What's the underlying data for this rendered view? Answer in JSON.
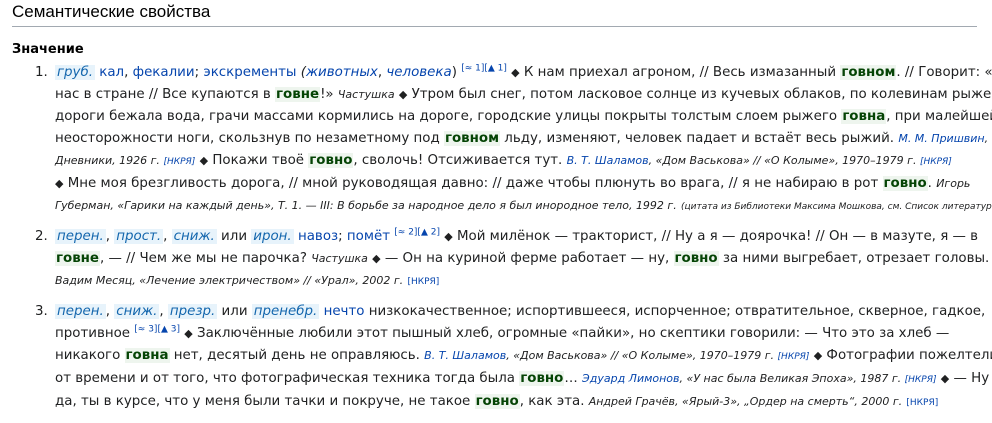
{
  "section_title": "Семантические свойства",
  "subsection_title": "Значение",
  "common": {
    "bullet": "◆",
    "nkrya": "[НКРЯ]"
  },
  "sense1": {
    "num": "1.",
    "label1": "груб.",
    "defs": "кал",
    "def2": "фекалии",
    "def3": "экскременты",
    "paren_open": "(",
    "paren_note1": "животных",
    "paren_note2": "человека",
    "paren_close": ")",
    "sup": "[≈ 1][▲ 1]",
    "q1_a": "К нам приехал агроном, // Весь измазанный ",
    "q1_hw": "говном",
    "q1_b": ". // Говорит: «У нас в стране // Все купаются в ",
    "q1_hw2": "говне",
    "q1_c": "!»",
    "q1_src": "Частушка",
    "q2_a": "Утром был снег, потом ласковое солнце из кучевых облаков, по колевинам рыжей дороги бежала вода, грачи массами кормились на дороге, городские улицы покрыты толстым слоем рыжего ",
    "q2_hw": "говна",
    "q2_b": ", при малейшей неосторожности ноги, скользнув по незаметному под ",
    "q2_hw2": "говном",
    "q2_c": " льду, изменяют, человек падает и встаёт весь рыжий.",
    "q2_src_author": "М. М. Пришвин",
    "q2_src_rest": ", Дневники, 1926 г.",
    "q3_a": "Покажи твоё ",
    "q3_hw": "говно",
    "q3_b": ", сволочь! Отсиживается тут.",
    "q3_src_author": "В. Т. Шаламов",
    "q3_src_rest": ", «Дом Васькова» // «О Колыме», 1970–1979 г.",
    "q4_a": "Мне моя брезгливость дорога, // мной руководящая давно: // даже чтобы плюнуть во врага, // я не набираю в рот ",
    "q4_hw": "говно",
    "q4_b": ".",
    "q4_src": "Игорь Губерман, «Гарики на каждый день», Т. 1. — III: В борьбе за народное дело я был инородное тело, 1992 г.",
    "q4_note": "(цитата из Библиотеки Максима Мошкова, см. Список литературы)"
  },
  "sense2": {
    "num": "2.",
    "label1": "перен.",
    "label2": "прост.",
    "label3": "сниж.",
    "or": " или ",
    "label4": "ирон.",
    "def1": "навоз",
    "def2": "помёт",
    "sup": "[≈ 2][▲ 2]",
    "q1_a": "Мой милёнок — тракторист, // Ну а я — доярочка! // Он — в мазуте, я — в ",
    "q1_hw": "говне",
    "q1_b": ", — // Чем же мы не парочка?",
    "q1_src": "Частушка",
    "q2_a": " — Он на куриной ферме работает — ну, ",
    "q2_hw": "говно",
    "q2_b": " за ними выгребает, отрезает головы.",
    "q2_src": "Вадим Месяц, «Лечение электричеством» // «Урал», 2002 г."
  },
  "sense3": {
    "num": "3.",
    "label1": "перен.",
    "label2": "сниж.",
    "label3": "презр.",
    "or": " или ",
    "label4": "пренебр.",
    "def1": "нечто",
    "def_rest": " низкокачественное; испортившееся, испорченное; отвратительное, скверное, гадкое, противное",
    "sup": "[≈ 3][▲ 3]",
    "q1_a": "Заключённые любили этот пышный хлеб, огромные «пайки», но скептики говорили: — Что это за хлеб — никакого ",
    "q1_hw": "говна",
    "q1_b": " нет, десятый день не оправляюсь.",
    "q1_src_author": "В. Т. Шаламов",
    "q1_src_rest": ", «Дом Васькова» // «О Колыме», 1970–1979 г.",
    "q2_a": "Фотографии пожелтели от времени и от того, что фотографическая техника тогда была ",
    "q2_hw": "говно",
    "q2_b": "…",
    "q2_src_author": "Эдуард Лимонов",
    "q2_src_rest": ", «У нас была Великая Эпоха», 1987 г.",
    "q3_a": " — Ну да, ты в курсе, что у меня были тачки и покруче, не такое ",
    "q3_hw": "говно",
    "q3_b": ", как эта.",
    "q3_src": "Андрей Грачёв, «Ярый-3», „Ордер на смерть“, 2000 г."
  }
}
